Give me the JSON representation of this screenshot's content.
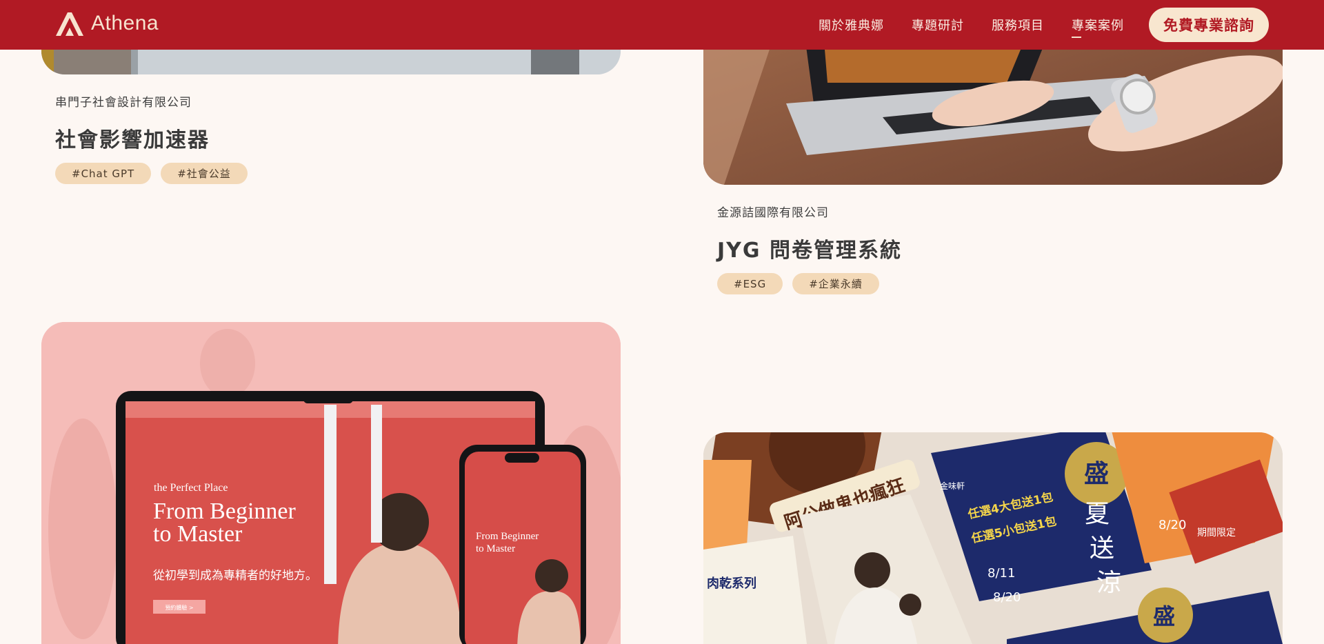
{
  "header": {
    "logo_text": "Athena",
    "nav": [
      {
        "label": "關於雅典娜",
        "active": false
      },
      {
        "label": "專題研討",
        "active": false
      },
      {
        "label": "服務項目",
        "active": false
      },
      {
        "label": "專案案例",
        "active": true
      }
    ],
    "cta_label": "免費專業諮詢"
  },
  "cards": [
    {
      "company": "串門子社會設計有限公司",
      "title": "社會影響加速器",
      "tags": [
        "#Chat GPT",
        "#社會公益"
      ]
    },
    {
      "company": "金源詰國際有限公司",
      "title": "JYG 問卷管理系統",
      "tags": [
        "#ESG",
        "#企業永續"
      ]
    }
  ],
  "mockup": {
    "small": "the Perfect Place",
    "headline_1": "From Beginner",
    "headline_2": "to Master",
    "sub": "從初學到成為專精者的好地方。",
    "button": "預約體驗 >"
  },
  "promo": {
    "crazy": "阿公做鬼也瘋狂",
    "summer_1": "盛",
    "summer_2": "夏",
    "summer_3": "送",
    "summer_4": "涼",
    "series": "肉乾系列",
    "deal_1": "任選4大包送1包",
    "deal_2": "任選5小包送1包",
    "date_1": "8/11",
    "date_2": "8/20",
    "limited": "期間限定",
    "brand": "金味軒"
  },
  "colors": {
    "header_bg": "#b11a24",
    "cta_bg": "#f8e6cf",
    "tag_bg": "#f3d9b8",
    "page_bg": "#fdf7f3"
  }
}
